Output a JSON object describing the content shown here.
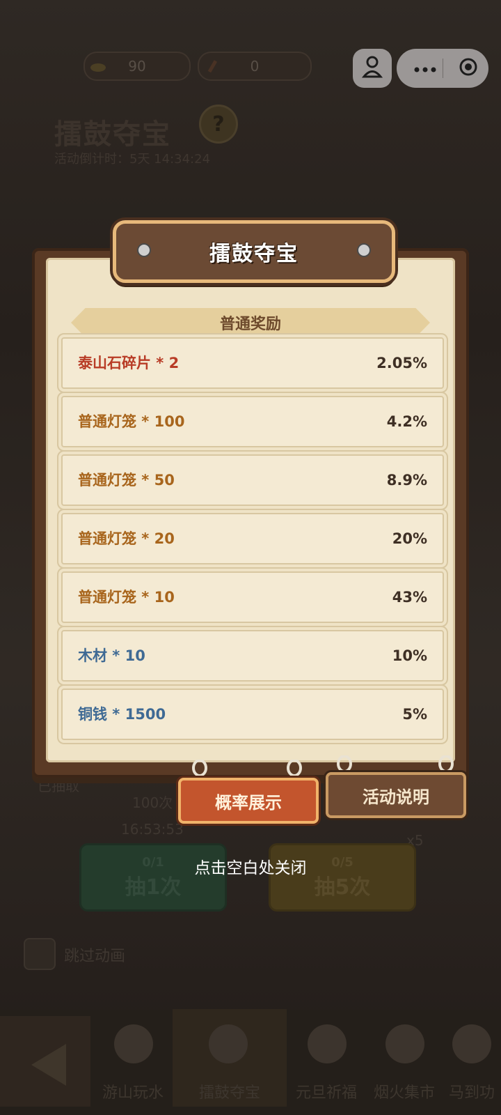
{
  "top": {
    "res1_value": "90",
    "res2_value": "0"
  },
  "activity": {
    "title": "擂鼓夺宝",
    "help_glyph": "?",
    "countdown": "活动倒计时：5天 14:34:24"
  },
  "background": {
    "drawn_label": "已抽取",
    "milestone": "100次",
    "timer": "16:53:53",
    "multiplier": "x5",
    "draw1_count": "0/1",
    "draw1_label": "抽1次",
    "draw5_count": "0/5",
    "draw5_label": "抽5次",
    "skip_anim": "跳过动画"
  },
  "tabs": [
    "游山玩水",
    "擂鼓夺宝",
    "元旦祈福",
    "烟火集市",
    "马到功"
  ],
  "dialog": {
    "title": "擂鼓夺宝",
    "section": "普通奖励",
    "rows": [
      {
        "name": "泰山石碎片 * 2",
        "pct": "2.05%"
      },
      {
        "name": "普通灯笼 * 100",
        "pct": "4.2%"
      },
      {
        "name": "普通灯笼 * 50",
        "pct": "8.9%"
      },
      {
        "name": "普通灯笼 * 20",
        "pct": "20%"
      },
      {
        "name": "普通灯笼 * 10",
        "pct": "43%"
      },
      {
        "name": "木材 * 10",
        "pct": "10%"
      },
      {
        "name": "铜钱 * 1500",
        "pct": "5%"
      }
    ],
    "btn_rate": "概率展示",
    "btn_info": "活动说明",
    "close_hint": "点击空白处关闭"
  },
  "colors": {
    "rare_red": "#b83c26",
    "lantern_brown": "#a8651c",
    "common_blue": "#3f6a94"
  }
}
